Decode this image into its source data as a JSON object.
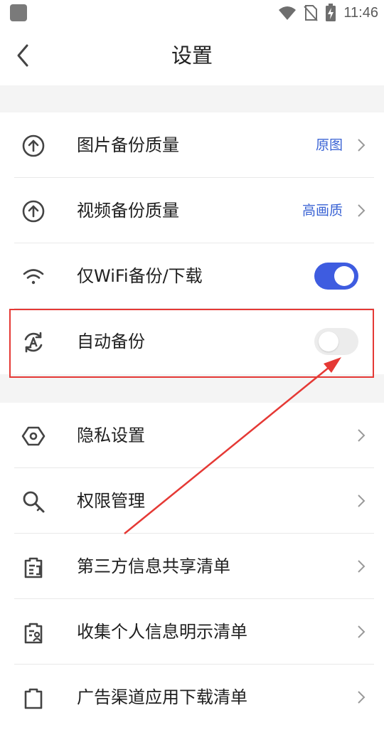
{
  "status_bar": {
    "time": "11:46"
  },
  "header": {
    "title": "设置",
    "back_icon": "chevron-left-icon"
  },
  "colors": {
    "accent": "#3e5ce0",
    "value_text": "#3a63d4",
    "highlight": "#e53935",
    "section_gap": "#f4f4f4"
  },
  "settings": {
    "photo_quality": {
      "label": "图片备份质量",
      "value": "原图",
      "icon": "upload-circle-icon"
    },
    "video_quality": {
      "label": "视频备份质量",
      "value": "高画质",
      "icon": "upload-circle-icon"
    },
    "wifi_only": {
      "label": "仅WiFi备份/下载",
      "icon": "wifi-icon",
      "enabled": true
    },
    "auto_backup": {
      "label": "自动备份",
      "icon": "auto-sync-icon",
      "enabled": false
    },
    "privacy": {
      "label": "隐私设置",
      "icon": "privacy-icon"
    },
    "permissions": {
      "label": "权限管理",
      "icon": "key-search-icon"
    },
    "third_party": {
      "label": "第三方信息共享清单",
      "icon": "share-list-icon"
    },
    "personal_info": {
      "label": "收集个人信息明示清单",
      "icon": "personal-info-icon"
    },
    "ad_downloads": {
      "label": "广告渠道应用下载清单",
      "icon": "download-list-icon"
    }
  }
}
